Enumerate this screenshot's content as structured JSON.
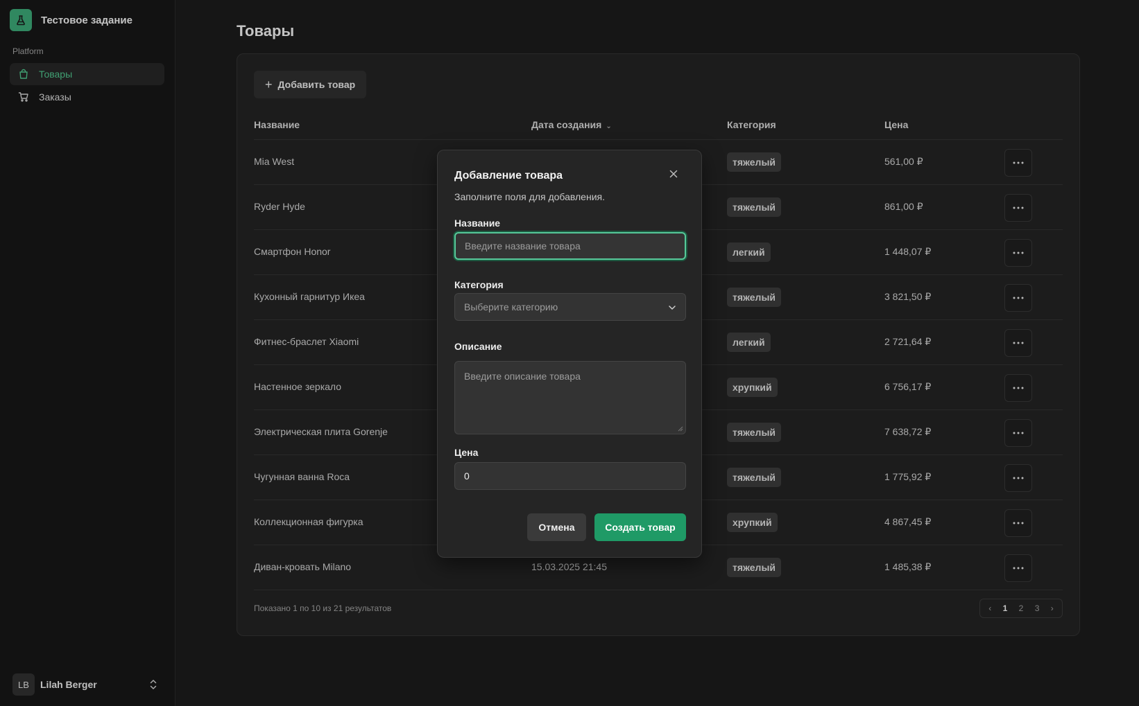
{
  "app": {
    "title": "Тестовое задание",
    "section": "Platform",
    "accent_color": "#3ba776",
    "nav": [
      {
        "label": "Товары",
        "icon": "shopping-bag-icon",
        "active": true
      },
      {
        "label": "Заказы",
        "icon": "cart-icon",
        "active": false
      }
    ],
    "user": {
      "initials": "LB",
      "name": "Lilah Berger"
    }
  },
  "page": {
    "title": "Товары",
    "add_button": "Добавить товар",
    "columns": {
      "name": "Название",
      "date": "Дата создания",
      "category": "Категория",
      "price": "Цена"
    },
    "rows": [
      {
        "name": "Mia West",
        "date": "",
        "category": "тяжелый",
        "price": "561,00 ₽"
      },
      {
        "name": "Ryder Hyde",
        "date": "",
        "category": "тяжелый",
        "price": "861,00 ₽"
      },
      {
        "name": "Смартфон Honor",
        "date": "",
        "category": "легкий",
        "price": "1 448,07 ₽"
      },
      {
        "name": "Кухонный гарнитур Икеа",
        "date": "",
        "category": "тяжелый",
        "price": "3 821,50 ₽"
      },
      {
        "name": "Фитнес-браслет Xiaomi",
        "date": "",
        "category": "легкий",
        "price": "2 721,64 ₽"
      },
      {
        "name": "Настенное зеркало",
        "date": "",
        "category": "хрупкий",
        "price": "6 756,17 ₽"
      },
      {
        "name": "Электрическая плита Gorenje",
        "date": "",
        "category": "тяжелый",
        "price": "7 638,72 ₽"
      },
      {
        "name": "Чугунная ванна Roca",
        "date": "",
        "category": "тяжелый",
        "price": "1 775,92 ₽"
      },
      {
        "name": "Коллекционная фигурка",
        "date": "",
        "category": "хрупкий",
        "price": "4 867,45 ₽"
      },
      {
        "name": "Диван-кровать Milano",
        "date": "15.03.2025 21:45",
        "category": "тяжелый",
        "price": "1 485,38 ₽"
      }
    ],
    "results_text": "Показано 1 по 10 из 21 результатов",
    "pagination": {
      "pages": [
        "1",
        "2",
        "3"
      ],
      "current": "1"
    }
  },
  "modal": {
    "title": "Добавление товара",
    "subtitle": "Заполните поля для добавления.",
    "name_label": "Название",
    "name_placeholder": "Введите название товара",
    "category_label": "Категория",
    "category_placeholder": "Выберите категорию",
    "description_label": "Описание",
    "description_placeholder": "Введите описание товара",
    "price_label": "Цена",
    "price_value": "0",
    "cancel_button": "Отмена",
    "create_button": "Создать товар",
    "create_color": "#1f9a66"
  }
}
